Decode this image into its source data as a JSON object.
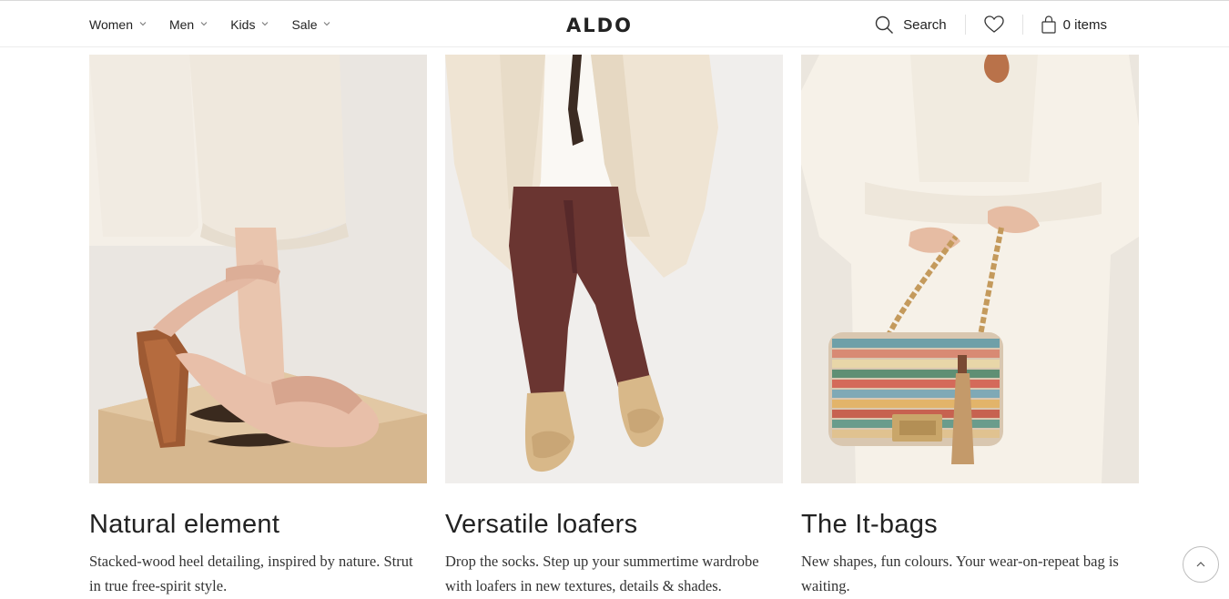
{
  "header": {
    "nav": [
      {
        "label": "Women"
      },
      {
        "label": "Men"
      },
      {
        "label": "Kids"
      },
      {
        "label": "Sale"
      }
    ],
    "logo": "ALDO",
    "search_label": "Search",
    "bag_label": "0 items"
  },
  "cards": [
    {
      "title": "Natural element",
      "text": "Stacked-wood heel detailing, inspired by nature. Strut in true free-spirit style."
    },
    {
      "title": "Versatile loafers",
      "text": "Drop the socks. Step up your summertime wardrobe with loafers in new textures, details & shades."
    },
    {
      "title": "The It-bags",
      "text": "New shapes, fun colours. Your wear-on-repeat bag is waiting."
    }
  ],
  "icons": {
    "chevron": "chevron-down-icon",
    "search": "search-icon",
    "wishlist": "heart-icon",
    "bag": "shopping-bag-icon",
    "scroll_top": "chevron-up-icon"
  }
}
